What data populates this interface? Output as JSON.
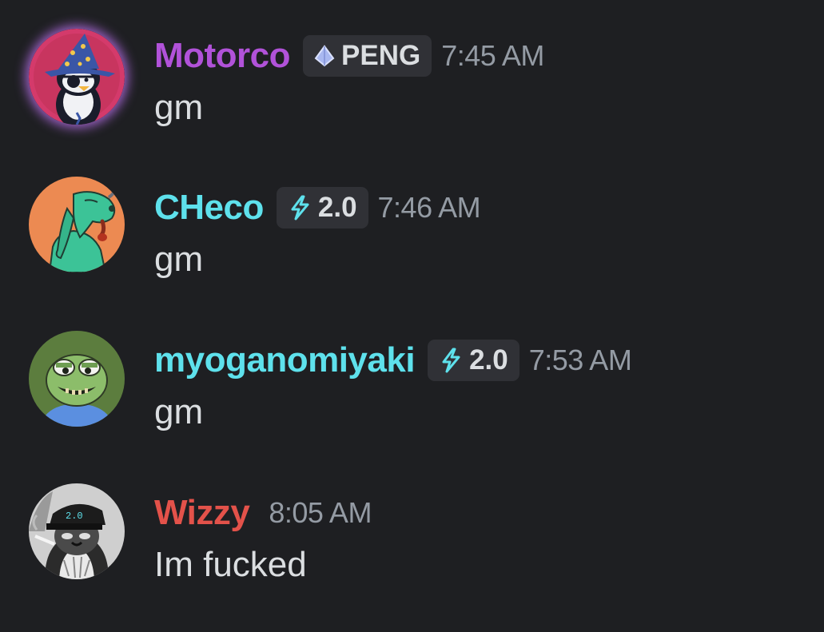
{
  "messages": [
    {
      "username": "Motorco",
      "username_color": "#b152d9",
      "tag": {
        "icon": "crystal-icon",
        "label": "PENG"
      },
      "timestamp": "7:45 AM",
      "content": "gm"
    },
    {
      "username": "CHeco",
      "username_color": "#5ee1ec",
      "tag": {
        "icon": "lightning-icon",
        "label": "2.0"
      },
      "timestamp": "7:46 AM",
      "content": "gm"
    },
    {
      "username": "myoganomiyaki",
      "username_color": "#5ee1ec",
      "tag": {
        "icon": "lightning-icon",
        "label": "2.0"
      },
      "timestamp": "7:53 AM",
      "content": "gm"
    },
    {
      "username": "Wizzy",
      "username_color": "#e3524a",
      "timestamp": "8:05 AM",
      "content": "Im fucked",
      "avatar_cap_text": "2.0"
    }
  ]
}
